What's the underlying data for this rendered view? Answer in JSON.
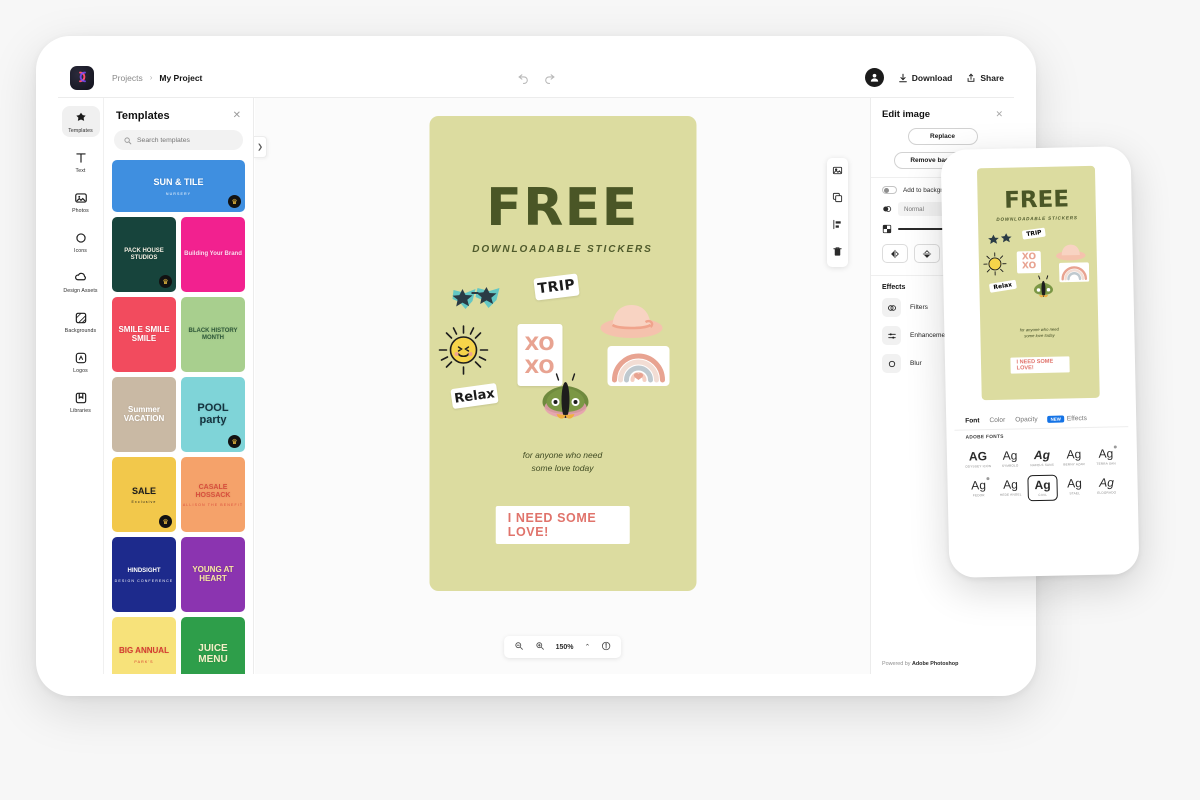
{
  "topbar": {
    "breadcrumb_root": "Projects",
    "breadcrumb_sep": "›",
    "breadcrumb_current": "My Project",
    "undo_icon": "undo-icon",
    "redo_icon": "redo-icon",
    "download_label": "Download",
    "share_label": "Share"
  },
  "rail": {
    "items": [
      {
        "label": "Templates",
        "icon": "templates-icon",
        "active": true
      },
      {
        "label": "Text",
        "icon": "text-icon",
        "active": false
      },
      {
        "label": "Photos",
        "icon": "photos-icon",
        "active": false
      },
      {
        "label": "Icons",
        "icon": "icons-icon",
        "active": false
      },
      {
        "label": "Design Assets",
        "icon": "design-assets-icon",
        "active": false
      },
      {
        "label": "Backgrounds",
        "icon": "backgrounds-icon",
        "active": false
      },
      {
        "label": "Logos",
        "icon": "logos-icon",
        "active": false
      },
      {
        "label": "Libraries",
        "icon": "libraries-icon",
        "active": false
      }
    ]
  },
  "panel": {
    "title": "Templates",
    "close_icon": "close-icon",
    "search_placeholder": "Search templates",
    "collapse_icon": "chevron-right-icon",
    "templates": [
      {
        "title": "SUN & TILE",
        "subtitle": "NURSERY",
        "bg": "#3f8fe0",
        "fg": "#ffffff",
        "size": 9,
        "wide": true,
        "premium": true
      },
      {
        "title": "PACK HOUSE STUDIOS",
        "subtitle": "",
        "bg": "#17443c",
        "fg": "#f3efe2",
        "size": 6,
        "wide": false,
        "premium": true
      },
      {
        "title": "Building Your Brand",
        "subtitle": "",
        "bg": "#f2218f",
        "fg": "#ffd9ef",
        "size": 6,
        "wide": false,
        "premium": false
      },
      {
        "title": "SMILE SMILE SMILE",
        "subtitle": "",
        "bg": "#f24b5e",
        "fg": "#ffffff",
        "size": 8,
        "wide": false,
        "premium": false
      },
      {
        "title": "BLACK HISTORY MONTH",
        "subtitle": "",
        "bg": "#a8cf8e",
        "fg": "#2f5a3a",
        "size": 6,
        "wide": false,
        "premium": false
      },
      {
        "title": "Summer VACATION",
        "subtitle": "",
        "bg": "#c9b9a4",
        "fg": "#ffffff",
        "size": 8,
        "wide": false,
        "premium": false
      },
      {
        "title": "POOL party",
        "subtitle": "",
        "bg": "#7fd4d8",
        "fg": "#14333f",
        "size": 11,
        "wide": false,
        "premium": true
      },
      {
        "title": "SALE",
        "subtitle": "Exclusive",
        "bg": "#f2c84b",
        "fg": "#1c1c1c",
        "size": 9,
        "wide": false,
        "premium": true
      },
      {
        "title": "CASALE HOSSACK",
        "subtitle": "ALLISON THE BENEFIT",
        "bg": "#f5a26a",
        "fg": "#d94f3d",
        "size": 7,
        "wide": false,
        "premium": false
      },
      {
        "title": "HINDSIGHT",
        "subtitle": "DESIGN CONFERENCE",
        "bg": "#1d2a8c",
        "fg": "#ffffff",
        "size": 6,
        "wide": false,
        "premium": false
      },
      {
        "title": "YOUNG AT HEART",
        "subtitle": "",
        "bg": "#8b34b0",
        "fg": "#f7e9a0",
        "size": 8,
        "wide": false,
        "premium": false
      },
      {
        "title": "BIG ANNUAL",
        "subtitle": "PARK'S",
        "bg": "#f7e27a",
        "fg": "#d63a2f",
        "size": 8,
        "wide": false,
        "premium": false
      },
      {
        "title": "JUICE MENU",
        "subtitle": "",
        "bg": "#2e9e4a",
        "fg": "#f5f0c8",
        "size": 10,
        "wide": false,
        "premium": false
      }
    ]
  },
  "canvas": {
    "title": "FREE",
    "subtitle": "DOWNLOADABLE STICKERS",
    "tagline": "for anyone who need\nsome love today",
    "cta_label": "I NEED SOME LOVE!",
    "background_color": "#dcdca0",
    "title_color": "#4a5626",
    "cta_color": "#e0736b",
    "stickers": [
      {
        "name": "star-sunglasses-sticker",
        "label": ""
      },
      {
        "name": "trip-sticker",
        "label": "TRIP"
      },
      {
        "name": "sun-hat-sticker",
        "label": ""
      },
      {
        "name": "sun-face-sticker",
        "label": ""
      },
      {
        "name": "xoxo-sticker",
        "label": "XO XO"
      },
      {
        "name": "rainbow-sticker",
        "label": ""
      },
      {
        "name": "relax-sticker",
        "label": "Relax"
      },
      {
        "name": "moth-sticker",
        "label": ""
      }
    ],
    "object_toolbar": [
      {
        "name": "crop-image-icon"
      },
      {
        "name": "duplicate-layer-icon"
      },
      {
        "name": "align-objects-icon"
      },
      {
        "name": "delete-icon"
      }
    ],
    "zoombar": {
      "zoom_out_icon": "zoom-out-icon",
      "zoom_in_icon": "zoom-in-icon",
      "zoom_value": "150%",
      "caret": "⌃",
      "info_icon": "info-icon"
    }
  },
  "editpanel": {
    "title": "Edit image",
    "close_icon": "close-icon",
    "replace_label": "Replace",
    "remove_bg_label": "Remove background",
    "add_to_background_label": "Add to background",
    "blend_mode": "Normal",
    "opacity_icon": "opacity-icon",
    "blend_icon": "blend-mode-icon",
    "align_buttons": [
      {
        "name": "flip-horizontal-icon"
      },
      {
        "name": "flip-vertical-icon"
      },
      {
        "name": "crop-icon"
      }
    ],
    "effects_title": "Effects",
    "effects": [
      {
        "label": "Filters",
        "icon": "filters-icon"
      },
      {
        "label": "Enhancements",
        "icon": "enhancements-icon"
      },
      {
        "label": "Blur",
        "icon": "blur-icon"
      }
    ],
    "powered_prefix": "Powered by ",
    "powered_brand": "Adobe Photoshop"
  },
  "phone": {
    "canvas": {
      "title": "FREE",
      "subtitle": "DOWNLOADABLE STICKERS",
      "tagline": "for anyone who need\nsome love today",
      "cta_label": "I NEED SOME LOVE!"
    },
    "tabs": [
      {
        "label": "Font",
        "active": true,
        "badge": ""
      },
      {
        "label": "Color",
        "active": false,
        "badge": ""
      },
      {
        "label": "Opacity",
        "active": false,
        "badge": ""
      },
      {
        "label": "Effects",
        "active": false,
        "badge": "NEW"
      }
    ],
    "fonts_section_label": "ADOBE FONTS",
    "fonts": [
      {
        "ag": "AG",
        "name": "ODYSSEY ICON",
        "style": "bold-sans",
        "selected": false,
        "dot": false
      },
      {
        "ag": "Ag",
        "name": "SYMBOLO",
        "style": "serif",
        "selected": false,
        "dot": false
      },
      {
        "ag": "Ag",
        "name": "NAFELS SANS",
        "style": "bold-italic",
        "selected": false,
        "dot": false
      },
      {
        "ag": "Ag",
        "name": "BERNY AZAR",
        "style": "light",
        "selected": false,
        "dot": false
      },
      {
        "ag": "Ag",
        "name": "TERRA SAN",
        "style": "sans",
        "selected": false,
        "dot": true
      },
      {
        "ag": "Ag",
        "name": "FEDOR",
        "style": "sans",
        "selected": false,
        "dot": true
      },
      {
        "ag": "Ag",
        "name": "HEDE ANGEL",
        "style": "sans",
        "selected": false,
        "dot": false
      },
      {
        "ag": "Ag",
        "name": "CIVIL",
        "style": "bold-sans",
        "selected": true,
        "dot": false
      },
      {
        "ag": "Ag",
        "name": "STAEL",
        "style": "serif",
        "selected": false,
        "dot": false
      },
      {
        "ag": "Ag",
        "name": "ELDORADO",
        "style": "script",
        "selected": false,
        "dot": false
      }
    ]
  }
}
